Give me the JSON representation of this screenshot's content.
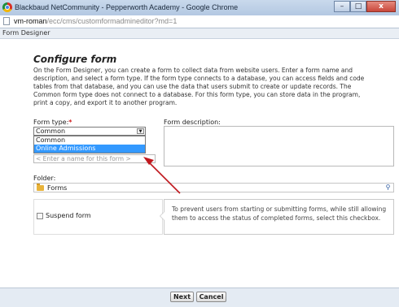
{
  "window": {
    "title": "Blackbaud NetCommunity - Pepperworth Academy - Google Chrome",
    "minimize": "–",
    "maximize": "□",
    "close": "x"
  },
  "address": {
    "host": "vm-roman",
    "path": "/ecc/cms/customformadmineditor?md=1"
  },
  "designer": {
    "title": "Form Designer"
  },
  "form": {
    "heading": "Configure form",
    "description": "On the Form Designer, you can create a form to collect data from website users. Enter a form name and description, and select a form type. If the form type connects to a database, you can access fields and code tables from that database, and you can use the data that users submit to create or update records. The Common form type does not connect to a database. For this form type, you can store data in the program, print a copy, and export it to another program.",
    "form_type_label": "Form type:",
    "required_marker": "*",
    "form_type_value": "Common",
    "form_type_options": [
      "Common",
      "Online Admissions"
    ],
    "selected_option_index": 1,
    "name_placeholder": "< Enter a name for this form >",
    "description_label": "Form description:",
    "folder_label": "Folder:",
    "folder_value": "Forms",
    "suspend_label": "Suspend form",
    "suspend_help": "To prevent users from starting or submitting forms, while still allowing them to access the status of completed forms, select this checkbox."
  },
  "footer": {
    "next_label": "Next",
    "cancel_label": "Cancel"
  },
  "colors": {
    "highlight": "#3399ff",
    "annotation_arrow": "#c0181d",
    "required": "#d01f1f"
  }
}
